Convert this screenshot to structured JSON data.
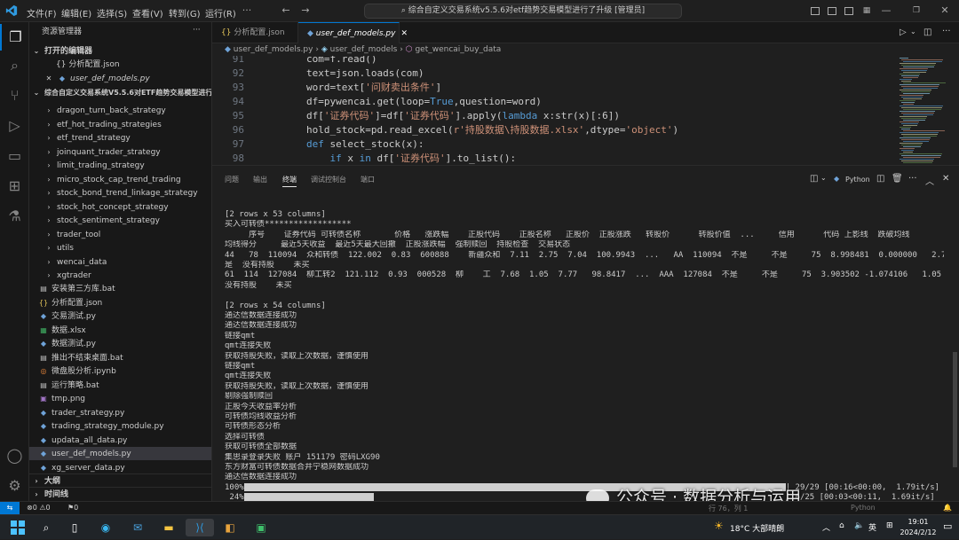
{
  "titlebar": {
    "menus": [
      "文件(F)",
      "编辑(E)",
      "选择(S)",
      "查看(V)",
      "转到(G)",
      "运行(R)"
    ],
    "command_center": "综合自定义交易系统v5.5.6对etf趋势交易模型进行了升级 [管理员]"
  },
  "sidebar": {
    "header": "资源管理器",
    "open_editors_label": "打开的编辑器",
    "open_editors": [
      "{} 分析配置.json",
      "user_def_models.py"
    ],
    "project_label": "综合自定义交易系统V5.5.6对ETF趋势交易模型进行了...",
    "folders": [
      "dragon_turn_back_strategy",
      "etf_hot_trading_strategies",
      "etf_trend_strategy",
      "joinquant_trader_strategy",
      "limit_trading_strategy",
      "micro_stock_cap_trend_trading",
      "stock_bond_trend_linkage_strategy",
      "stock_hot_concept_strategy",
      "stock_sentiment_strategy",
      "trader_tool",
      "utils",
      "wencai_data",
      "xgtrader"
    ],
    "files": [
      {
        "name": "安装第三方库.bat",
        "icon": "bat"
      },
      {
        "name": "分析配置.json",
        "icon": "json"
      },
      {
        "name": "交易测试.py",
        "icon": "py"
      },
      {
        "name": "数据.xlsx",
        "icon": "xlsx"
      },
      {
        "name": "数据测试.py",
        "icon": "py"
      },
      {
        "name": "推出不结束桌面.bat",
        "icon": "bat"
      },
      {
        "name": "微盘股分析.ipynb",
        "icon": "ipynb"
      },
      {
        "name": "运行策略.bat",
        "icon": "bat"
      },
      {
        "name": "tmp.png",
        "icon": "png"
      },
      {
        "name": "trader_strategy.py",
        "icon": "py"
      },
      {
        "name": "trading_strategy_module.py",
        "icon": "py"
      },
      {
        "name": "updata_all_data.py",
        "icon": "py"
      },
      {
        "name": "user_def_models.py",
        "icon": "py"
      },
      {
        "name": "xg_server_data.py",
        "icon": "py"
      }
    ],
    "outline_label": "大纲",
    "timeline_label": "时间线"
  },
  "editor": {
    "tabs": [
      "分析配置.json",
      "user_def_models.py"
    ],
    "breadcrumb": [
      "user_def_models.py",
      "user_def_models",
      "get_wencai_buy_data"
    ],
    "lines": [
      {
        "n": "91",
        "text": "com=f.read()"
      },
      {
        "n": "92",
        "text": "text=json.loads(com)"
      },
      {
        "n": "93",
        "text": "word=text['问财卖出条件']"
      },
      {
        "n": "94",
        "text": "df=pywencai.get(loop=True,question=word)"
      },
      {
        "n": "95",
        "text": "df['证券代码']=df['证券代码'].apply(lambda x:str(x)[:6])"
      },
      {
        "n": "96",
        "text": "hold_stock=pd.read_excel(r'持股数据\\持股数据.xlsx',dtype='object')"
      },
      {
        "n": "97",
        "text": "def select_stock(x):"
      },
      {
        "n": "98",
        "text": "    if x in df['证券代码'].to_list():"
      }
    ]
  },
  "panel": {
    "tabs": [
      "问题",
      "输出",
      "终端",
      "调试控制台",
      "端口"
    ],
    "active_tab": "终端",
    "shell_label": "Python",
    "terminal_lines": [
      "[2 rows x 53 columns]",
      "买入可转债******************",
      "     序号    证券代码 可转债名称       价格   涨跌幅    正股代码    正股名称   正股价  正股涨跌   转股价      转股价值  ...     信用      代码 上影线  跌破均线",
      "均线得分     最近5天收益  最近5天最大回撤  正股涨跌幅  强制赎回  持股检查  交易状态",
      "44   78  110094  众和转债  122.002  0.83  600888    新疆众和  7.11  2.75  7.04  100.9943  ...   AA  110094  不是     不是     75  8.998481  0.000000   2.75     不",
      "是  没有持股    未买",
      "61  114  127084  柳工转2  121.112  0.93  000528  柳    工  7.68  1.05  7.77   98.8417  ...  AAA  127084  不是     不是     75  3.903502 -1.074106   1.05     不是",
      "没有持股    未买",
      "",
      "[2 rows x 54 columns]",
      "通达信数据连接成功",
      "通达信数据连接成功",
      "链接qmt",
      "qmt连接失败",
      "获取持股失败，读取上次数据，谨慎使用",
      "链接qmt",
      "qmt连接失败",
      "获取持股失败，读取上次数据，谨慎使用",
      "剔除强制赎回",
      "正股今天收益率分析",
      "可转债均线收益分析",
      "可转债形态分析",
      "选择可转债",
      "获取可转债全部数据",
      "集思录登录失败 账户 151179 密码LXG90",
      "东方财富可转债数据合并宁稳网数据成功",
      "通达信数据连接成功"
    ],
    "progress": [
      {
        "pct": "100%",
        "value": 1.0,
        "stats": "| 29/29 [00:16<00:00,  1.79it/s]"
      },
      {
        "pct": " 24%",
        "value": 0.24,
        "stats": "| 6/25 [00:03<00:11,  1.69it/s]"
      }
    ]
  },
  "statusbar": {
    "errors": "0",
    "warnings": "0",
    "ports": "0",
    "cursor": "行 76，列 1",
    "language": "Python"
  },
  "watermark": "公众号 · 数据分析与运用",
  "taskbar": {
    "weather": "18°C 大部晴朗",
    "lang": "英",
    "time": "19:01",
    "date": "2024/2/12"
  }
}
